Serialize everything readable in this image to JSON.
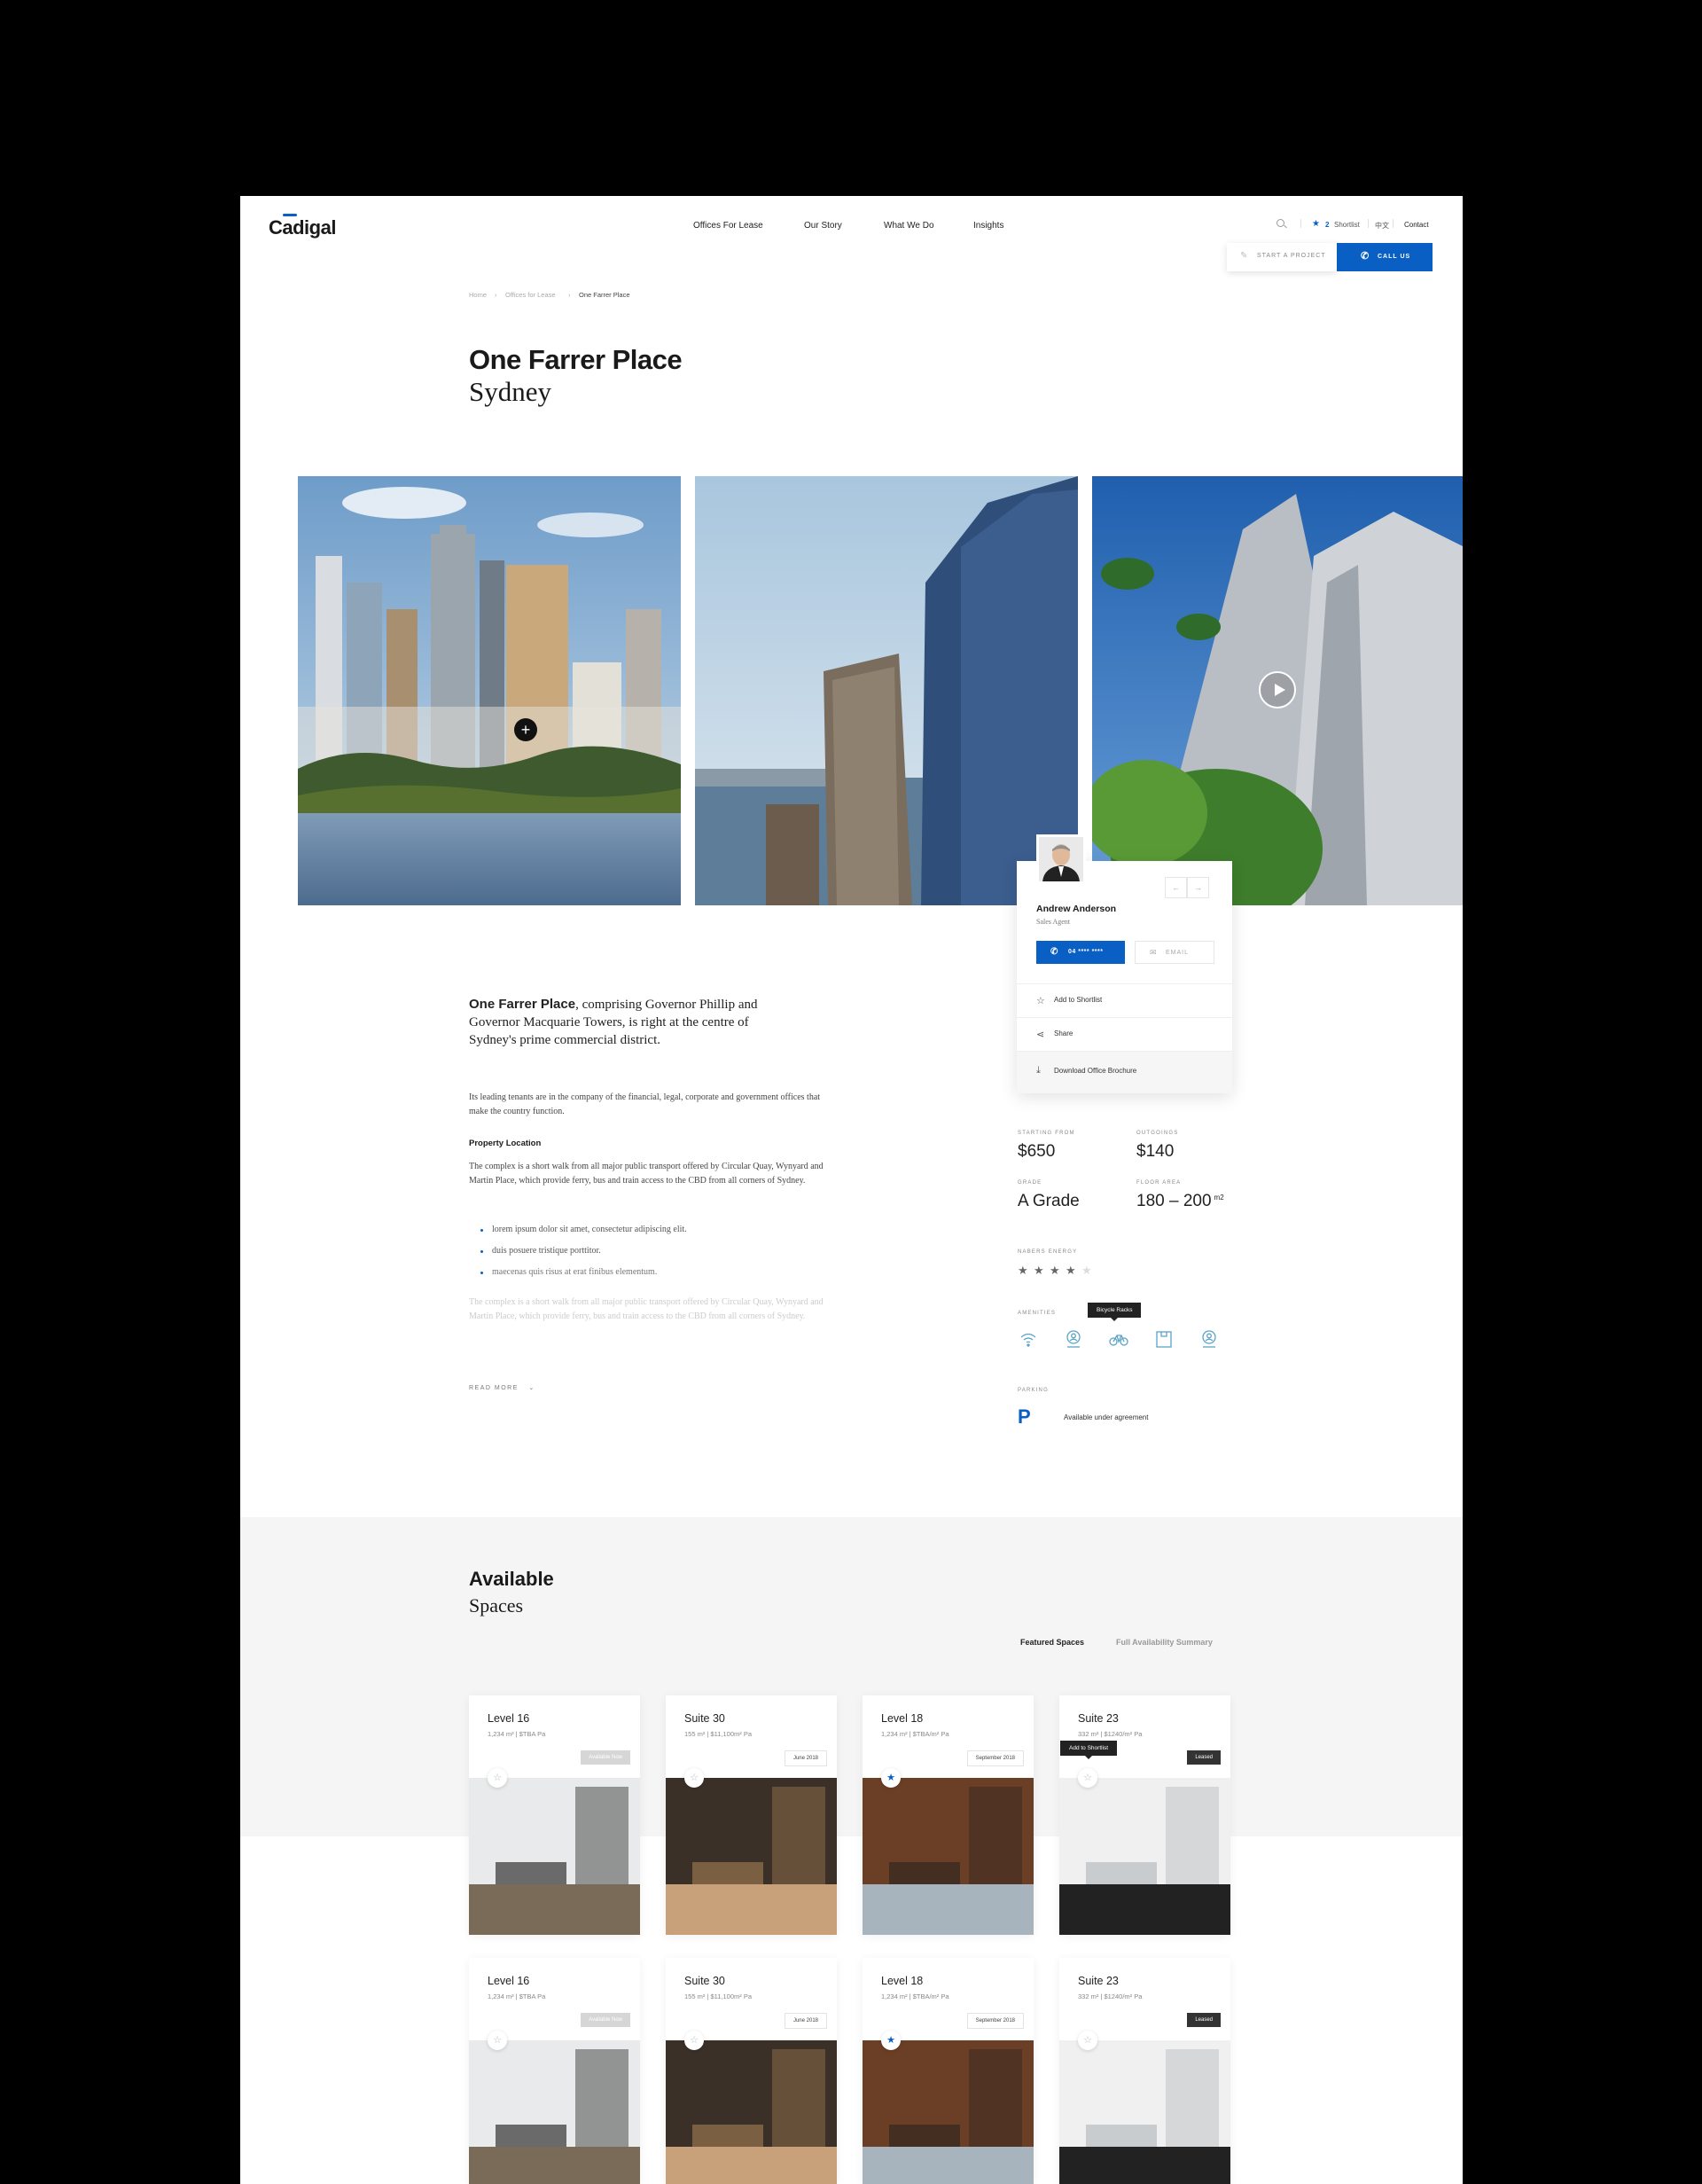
{
  "header": {
    "logo": "Cadigal",
    "nav": [
      "Offices For Lease",
      "Our Story",
      "What We Do",
      "Insights"
    ],
    "shortlist_count": "2",
    "shortlist_label": "Shortlist",
    "language": "中文",
    "contact": "Contact",
    "start_project": "START A PROJECT",
    "call_us": "CALL US"
  },
  "breadcrumb": [
    "Home",
    "Offices for Lease",
    "One Farrer Place"
  ],
  "property": {
    "name": "One Farrer Place",
    "city": "Sydney"
  },
  "agent": {
    "name": "Andrew Anderson",
    "role": "Sales Agent",
    "phone": "04 **** ****",
    "email_label": "EMAIL",
    "prev": "←",
    "next": "→",
    "actions": [
      "Add to Shortlist",
      "Share",
      "Download Office Brochure"
    ]
  },
  "description": {
    "lead_bold": "One Farrer Place",
    "lead_rest": ", comprising Governor Phillip and Governor Macquarie Towers, is right at the centre of Sydney's prime commercial district.",
    "para": "Its leading tenants are in the company of the financial, legal, corporate and government offices that make the country function.",
    "location_heading": "Property Location",
    "location_text": "The complex is a short walk from all major public transport offered by Circular Quay, Wynyard and Martin Place, which provide ferry, bus and train access to the CBD from all corners of Sydney.",
    "bullets": [
      "lorem ipsum dolor sit amet, consectetur adipiscing elit.",
      "duis posuere tristique porttitor.",
      "maecenas quis risus at erat finibus elementum."
    ],
    "faded": "The complex is a short walk from all major public transport offered by Circular Quay, Wynyard and Martin Place, which provide ferry, bus and train access to the CBD from all corners of Sydney.",
    "read_more": "READ MORE"
  },
  "stats": {
    "starting_label": "STARTING FROM",
    "starting": "$650",
    "outgoings_label": "OUTGOINGS",
    "outgoings": "$140",
    "grade_label": "GRADE",
    "grade": "A Grade",
    "area_label": "FLOOR AREA",
    "area": "180 – 200",
    "area_unit": "m2",
    "energy_label": "NABERS ENERGY",
    "energy_rating": 4,
    "energy_max": 5,
    "amenities_label": "AMENITIES",
    "amenities": [
      "wifi-icon",
      "person-pin-icon",
      "bicycle-icon",
      "locker-icon",
      "person-pin-icon"
    ],
    "amenity_tooltip": "Bicycle Racks",
    "parking_label": "PARKING",
    "parking_symbol": "P",
    "parking_text": "Available under agreement"
  },
  "available": {
    "title": "Available",
    "subtitle": "Spaces",
    "tabs": [
      "Featured Spaces",
      "Full Availability Summary"
    ],
    "shortlist_tooltip": "Add to Shortlist",
    "cards": [
      {
        "title": "Level 16",
        "meta": "1,234 m²  |  $TBA Pa",
        "badge": "Available Now",
        "style": "gray",
        "starred": false
      },
      {
        "title": "Suite 30",
        "meta": "155 m²  |  $11,100m² Pa",
        "badge": "June 2018",
        "style": "line",
        "starred": false
      },
      {
        "title": "Level 18",
        "meta": "1,234 m²  |  $TBA/m² Pa",
        "badge": "September 2018",
        "style": "line",
        "starred": true
      },
      {
        "title": "Suite 23",
        "meta": "332 m²  |  $1240/m² Pa",
        "badge": "Leased",
        "style": "dark",
        "starred": false
      },
      {
        "title": "Level 16",
        "meta": "1,234 m²  |  $TBA Pa",
        "badge": "Available Now",
        "style": "gray",
        "starred": false
      },
      {
        "title": "Suite 30",
        "meta": "155 m²  |  $11,100m² Pa",
        "badge": "June 2018",
        "style": "line",
        "starred": false
      },
      {
        "title": "Level 18",
        "meta": "1,234 m²  |  $TBA/m² Pa",
        "badge": "September 2018",
        "style": "line",
        "starred": true
      },
      {
        "title": "Suite 23",
        "meta": "332 m²  |  $1240/m² Pa",
        "badge": "Leased",
        "style": "dark",
        "starred": false
      }
    ]
  },
  "colors": {
    "accent": "#0a5fc4",
    "dark": "#222222"
  }
}
